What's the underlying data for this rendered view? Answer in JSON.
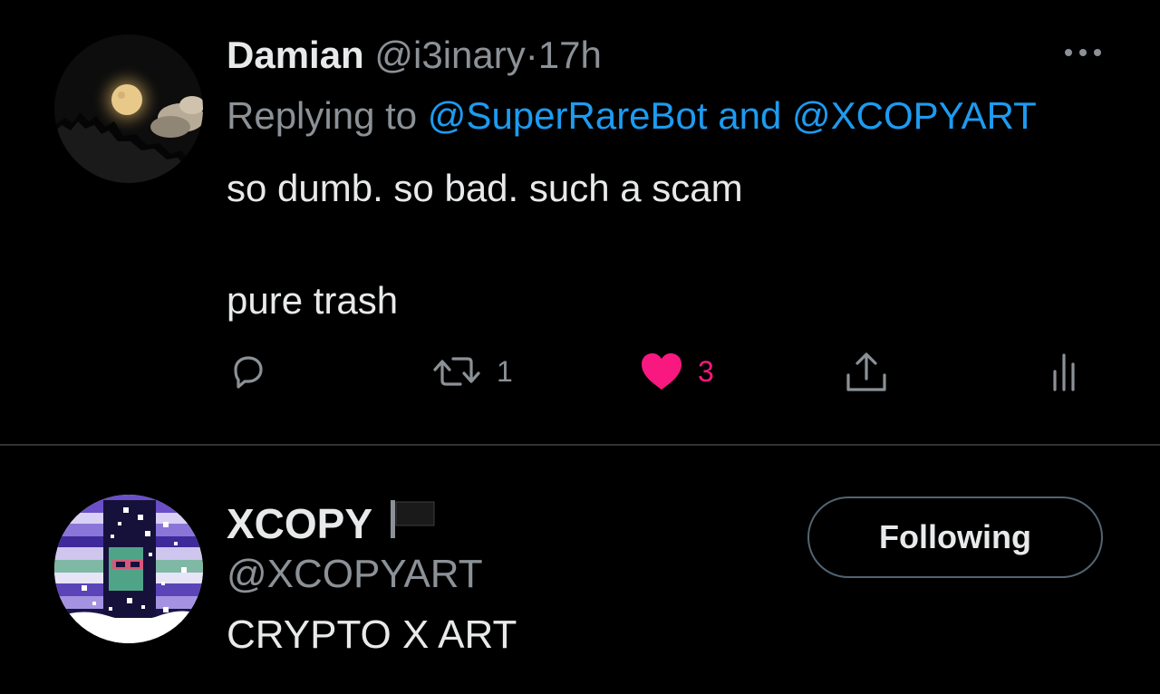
{
  "tweet": {
    "author_name": "Damian",
    "author_handle": "@i3inary",
    "separator": "·",
    "time": "17h",
    "replying_prefix": "Replying to",
    "mention_1": "@SuperRareBot",
    "mention_joiner": "and",
    "mention_2": "@XCOPYART",
    "text_line_1": "so dumb.  so bad.  such a scam",
    "text_line_2": "pure trash",
    "more_icon": "more-horizontal-icon",
    "actions": {
      "reply_icon": "reply-bubble-icon",
      "retweet_icon": "retweet-icon",
      "retweet_count": "1",
      "like_icon": "heart-filled-icon",
      "like_count": "3",
      "share_icon": "share-upload-icon",
      "views_icon": "views-bars-icon"
    }
  },
  "user_card": {
    "name": "XCOPY",
    "flag_icon": "black-flag-icon",
    "handle": "@XCOPYART",
    "bio": "CRYPTO X ART",
    "follow_label": "Following"
  },
  "colors": {
    "background": "#000000",
    "text_primary": "#e7e9ea",
    "text_secondary": "#8b9196",
    "link": "#1d9bf0",
    "like": "#f91880",
    "divider": "#2f3336"
  }
}
